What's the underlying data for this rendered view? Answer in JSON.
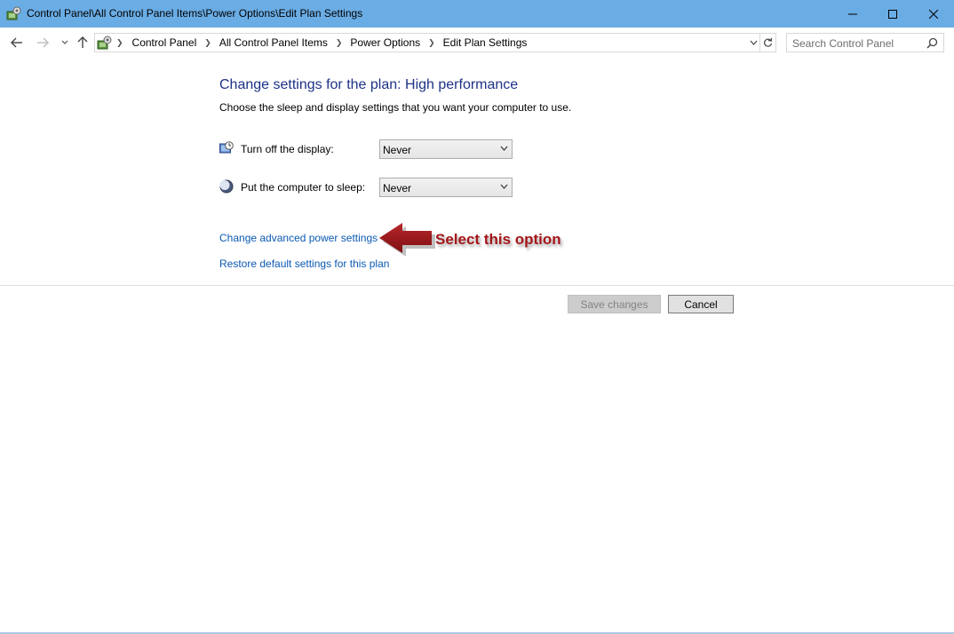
{
  "window": {
    "title": "Control Panel\\All Control Panel Items\\Power Options\\Edit Plan Settings"
  },
  "breadcrumb": {
    "items": [
      "Control Panel",
      "All Control Panel Items",
      "Power Options",
      "Edit Plan Settings"
    ]
  },
  "search": {
    "placeholder": "Search Control Panel"
  },
  "main": {
    "heading": "Change settings for the plan: High performance",
    "subtext": "Choose the sleep and display settings that you want your computer to use.",
    "display_setting": {
      "label": "Turn off the display:",
      "value": "Never"
    },
    "sleep_setting": {
      "label": "Put the computer to sleep:",
      "value": "Never"
    },
    "advanced_link": "Change advanced power settings",
    "restore_link": "Restore default settings for this plan",
    "callout": "Select this option"
  },
  "buttons": {
    "save": "Save changes",
    "cancel": "Cancel"
  },
  "colors": {
    "titlebar": "#6aace4",
    "heading": "#1e3287",
    "link": "#0b59b2",
    "callout": "#a4161a"
  }
}
